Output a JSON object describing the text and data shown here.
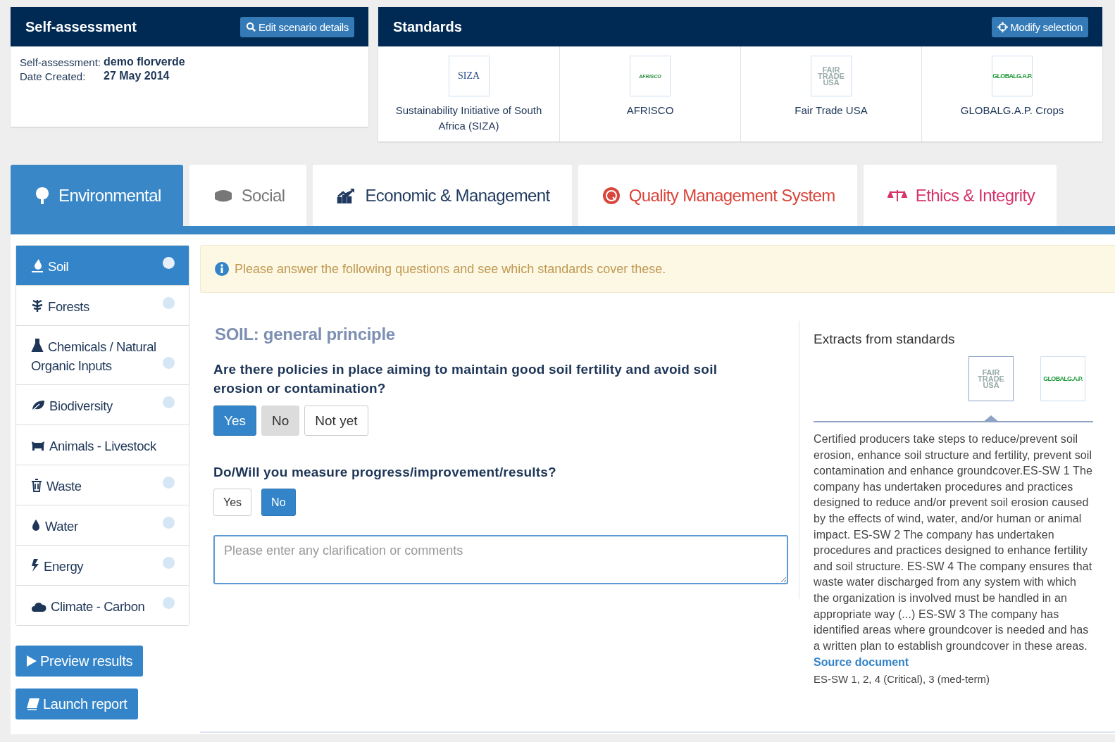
{
  "assessment": {
    "title": "Self-assessment",
    "edit_button": "Edit scenario details",
    "fields": [
      {
        "label": "Self-assessment:",
        "value": "demo florverde"
      },
      {
        "label": "Date Created:",
        "value": "27 May 2014"
      }
    ]
  },
  "standards": {
    "title": "Standards",
    "modify_button": "Modify selection",
    "items": [
      {
        "name": "Sustainability Initiative of South Africa (SIZA)",
        "logo_text": "SIZA"
      },
      {
        "name": "AFRISCO",
        "logo_text": "AFRISCO"
      },
      {
        "name": "Fair Trade USA",
        "logo_text": "FAIR TRADE USA"
      },
      {
        "name": "GLOBALG.A.P. Crops",
        "logo_text": "GLOBALG.A.P."
      }
    ]
  },
  "tabs": [
    {
      "label": "Environmental",
      "selected": true,
      "color": "#ffffff"
    },
    {
      "label": "Social",
      "selected": false,
      "color": "#777777"
    },
    {
      "label": "Economic & Management",
      "selected": false,
      "color": "#1f3a5f"
    },
    {
      "label": "Quality Management System",
      "selected": false,
      "color": "#d9453a"
    },
    {
      "label": "Ethics & Integrity",
      "selected": false,
      "color": "#d6336c"
    }
  ],
  "sidebar": {
    "items": [
      {
        "label": "Soil",
        "selected": true,
        "dot": true
      },
      {
        "label": "Forests",
        "selected": false,
        "dot": true
      },
      {
        "label": "Chemicals / Natural Organic Inputs",
        "selected": false,
        "dot": true
      },
      {
        "label": "Biodiversity",
        "selected": false,
        "dot": true
      },
      {
        "label": "Animals - Livestock",
        "selected": false,
        "dot": false
      },
      {
        "label": "Waste",
        "selected": false,
        "dot": true
      },
      {
        "label": "Water",
        "selected": false,
        "dot": true
      },
      {
        "label": "Energy",
        "selected": false,
        "dot": true
      },
      {
        "label": "Climate - Carbon",
        "selected": false,
        "dot": true
      }
    ],
    "buttons": [
      "Preview results",
      "Launch report"
    ]
  },
  "alert": "Please answer the following questions and see which standards cover these.",
  "section_title": "SOIL: general principle",
  "questions": [
    {
      "text": "Are there policies in place aiming to maintain good soil fertility and avoid soil erosion or contamination?",
      "compact": false,
      "options": [
        {
          "label": "Yes",
          "selected": true,
          "shaded": false
        },
        {
          "label": "No",
          "selected": false,
          "shaded": true
        },
        {
          "label": "Not yet",
          "selected": false,
          "shaded": false
        }
      ]
    },
    {
      "text": "Do/Will you measure progress/improvement/results?",
      "compact": true,
      "options": [
        {
          "label": "Yes",
          "selected": false,
          "shaded": false
        },
        {
          "label": "No",
          "selected": true,
          "shaded": false
        }
      ]
    }
  ],
  "comment": {
    "placeholder": "Please enter any clarification or comments"
  },
  "extracts": {
    "title": "Extracts from standards",
    "logos": [
      {
        "logo_text": "FAIR TRADE USA",
        "selected": true
      },
      {
        "logo_text": "GLOBALG.A.P.",
        "selected": false
      }
    ],
    "text": "Certified producers take steps to reduce/prevent soil erosion, enhance soil structure and fertility, prevent soil contamination and enhance groundcover.ES-SW 1 The company has undertaken procedures and practices designed to reduce and/or prevent soil erosion caused by the effects of wind, water, and/or human or animal impact. ES-SW 2 The company has undertaken procedures and practices designed to enhance fertility and soil structure. ES-SW 4 The company ensures that waste water discharged from any system with which the organization is involved must be handled in an appropriate way (...) ES-SW 3 The company has identified areas where groundcover is needed and has a written plan to establish groundcover in these areas.",
    "link": "Source document",
    "reference": "ES-SW 1, 2, 4 (Critical), 3 (med-term)"
  }
}
